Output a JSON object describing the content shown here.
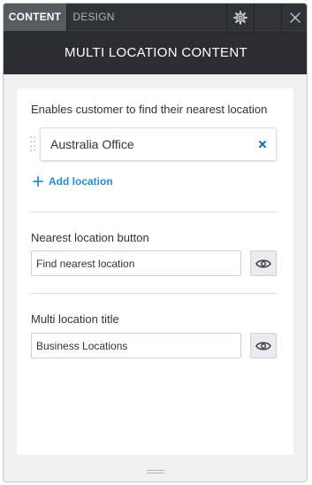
{
  "topbar": {
    "tabs": [
      {
        "label": "CONTENT",
        "active": true
      },
      {
        "label": "DESIGN",
        "active": false
      }
    ],
    "buttons": {
      "settings_icon": "gear-icon",
      "close_icon": "close-icon"
    }
  },
  "header": {
    "title": "MULTI LOCATION CONTENT"
  },
  "content": {
    "locations_label": "Enables customer to find their nearest location",
    "locations": [
      {
        "name": "Australia Office"
      }
    ],
    "add_location_label": "Add location",
    "nearest_button": {
      "label": "Nearest location button",
      "value": "Find nearest location",
      "eye_icon": "eye-icon"
    },
    "multi_title": {
      "label": "Multi location title",
      "value": "Business Locations",
      "eye_icon": "eye-icon"
    }
  },
  "colors": {
    "topbar_bg": "#2f3338",
    "header_bg": "#2a2d31",
    "accent": "#2a8bd2",
    "panel_bg": "#f0f0f0"
  }
}
